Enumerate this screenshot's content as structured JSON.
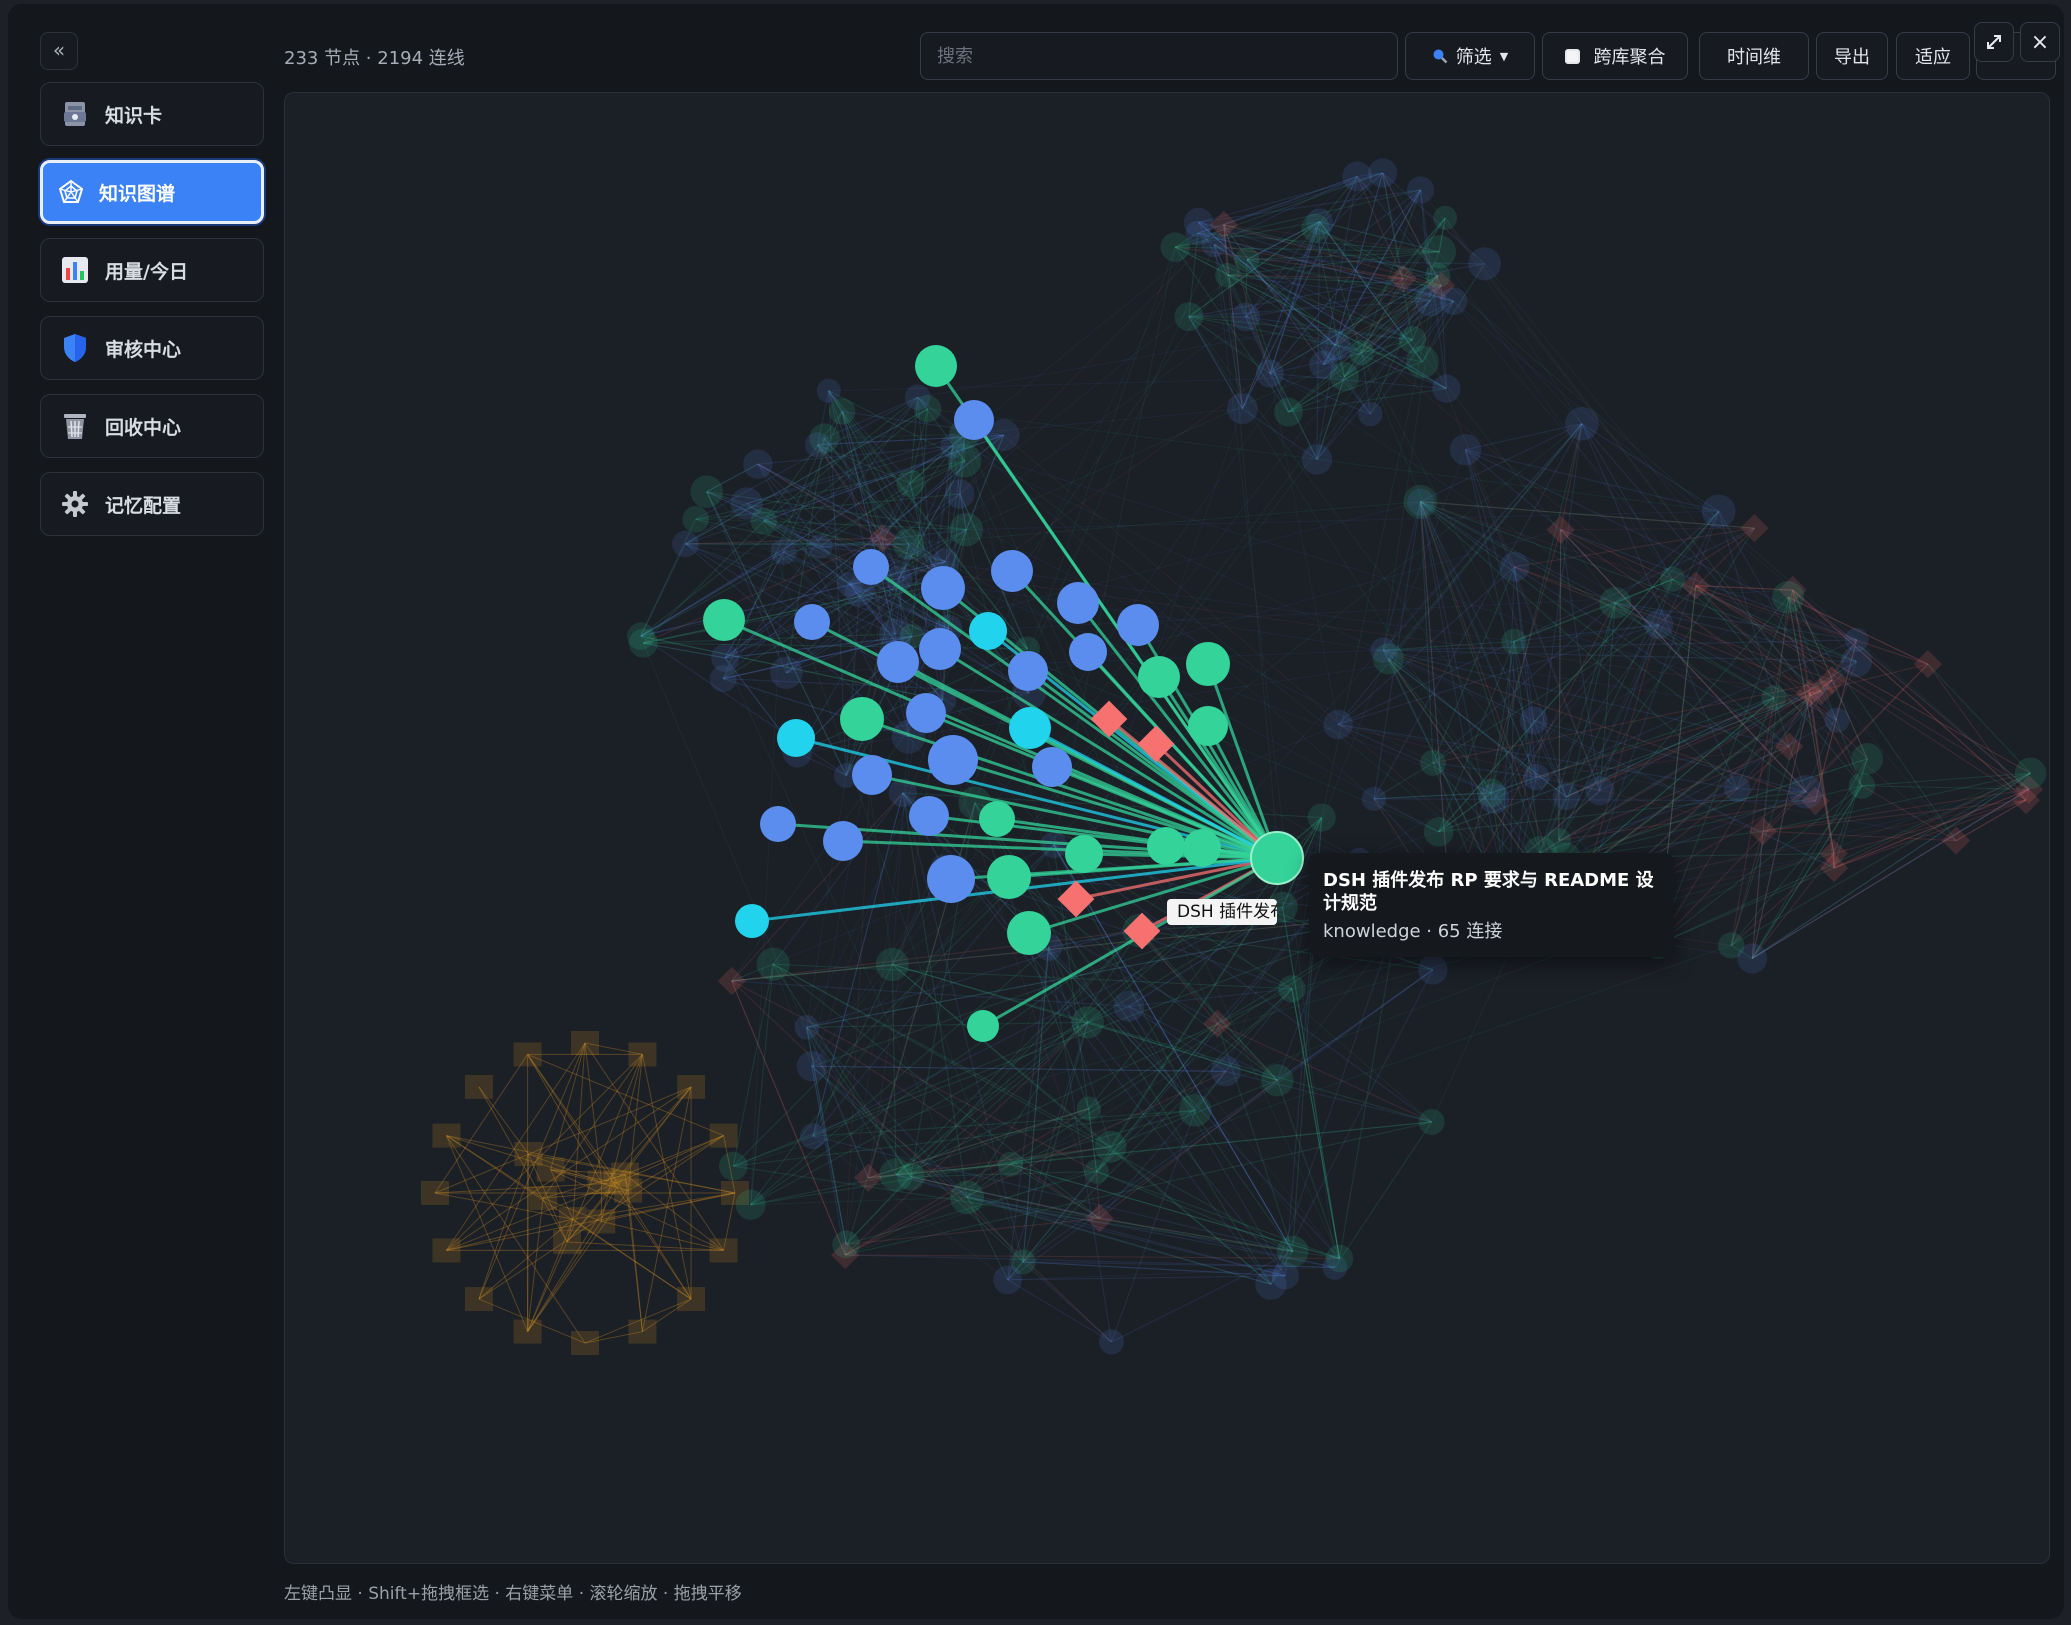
{
  "sidebar": {
    "collapse_label": "«",
    "items": [
      {
        "label": "知识卡",
        "icon": "card-index-icon"
      },
      {
        "label": "知识图谱",
        "icon": "graph-icon"
      },
      {
        "label": "用量/今日",
        "icon": "bar-chart-icon"
      },
      {
        "label": "审核中心",
        "icon": "shield-icon"
      },
      {
        "label": "回收中心",
        "icon": "wastebasket-icon"
      },
      {
        "label": "记忆配置",
        "icon": "gear-icon"
      }
    ],
    "active_index": 1
  },
  "toolbar": {
    "stats": "233 节点 · 2194 连线",
    "search_placeholder": "搜索",
    "search_value": "",
    "filter_label": "筛选",
    "cross_lib_label": "跨库聚合",
    "cross_lib_checked": false,
    "timeline_label": "时间维",
    "export_label": "导出",
    "fit_label": "适应",
    "expand_icon": "expand-icon",
    "close_label": "×"
  },
  "graph": {
    "colors": {
      "knowledge": "#34d399",
      "entity": "#5b8def",
      "concept": "#22d3ee",
      "risk": "#f87171",
      "isolated": "#c98a24"
    },
    "selected_label": "DSH 插件发布 RP 要求与 README 设计规范"
  },
  "tooltip": {
    "title": "DSH 插件发布 RP 要求与 README 设计规范",
    "meta": "knowledge · 65 连接"
  },
  "hint": "左键凸显 · Shift+拖拽框选 · 右键菜单 · 滚轮缩放 · 拖拽平移"
}
